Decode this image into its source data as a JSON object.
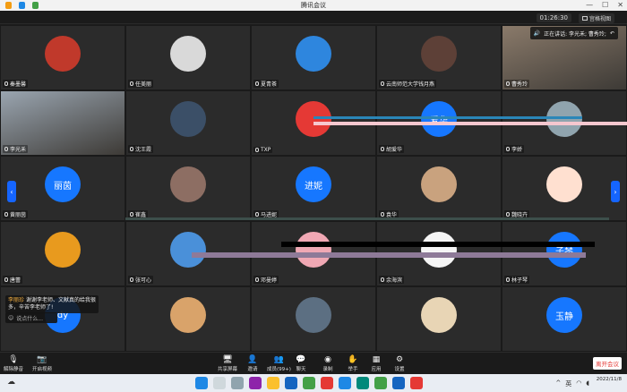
{
  "window": {
    "title": "腾讯会议",
    "controls": [
      "—",
      "☐",
      "✕"
    ]
  },
  "topbar": {
    "timer": "01:26:30",
    "gallery_label": "宫格视图"
  },
  "speaking": {
    "label": "正在讲话: 李光禾; 曹秀玲;"
  },
  "participants": [
    {
      "name": "秦墨馨",
      "kind": "avatar",
      "color": "#c0392b",
      "initial": ""
    },
    {
      "name": "任美丽",
      "kind": "avatar",
      "color": "#d9d9d9",
      "initial": ""
    },
    {
      "name": "夏青茶",
      "kind": "avatar",
      "color": "#2e86de",
      "initial": ""
    },
    {
      "name": "云南师范大学钱月燕",
      "kind": "avatar",
      "color": "#5d4037",
      "initial": ""
    },
    {
      "name": "曹秀玲",
      "kind": "video",
      "color": "#8a7a6a",
      "initial": ""
    },
    {
      "name": "李光禾",
      "kind": "video",
      "color": "#9aa5b0",
      "initial": ""
    },
    {
      "name": "沈王霞",
      "kind": "avatar",
      "color": "#3b4f67",
      "initial": ""
    },
    {
      "name": "TXP",
      "kind": "avatar",
      "color": "#e53935",
      "initial": ""
    },
    {
      "name": "胡爱华",
      "kind": "avatar",
      "color": "#1677ff",
      "initial": "爱华"
    },
    {
      "name": "李娇",
      "kind": "avatar",
      "color": "#90a4ae",
      "initial": ""
    },
    {
      "name": "黄丽茵",
      "kind": "avatar",
      "color": "#1677ff",
      "initial": "丽茵"
    },
    {
      "name": "崔鑫",
      "kind": "avatar",
      "color": "#8d6e63",
      "initial": ""
    },
    {
      "name": "马进妮",
      "kind": "avatar",
      "color": "#1677ff",
      "initial": "进妮"
    },
    {
      "name": "袁华",
      "kind": "avatar",
      "color": "#c9a27e",
      "initial": ""
    },
    {
      "name": "魏晓卉",
      "kind": "avatar",
      "color": "#ffe0d0",
      "initial": ""
    },
    {
      "name": "唐蕾",
      "kind": "avatar",
      "color": "#e89a1e",
      "initial": ""
    },
    {
      "name": "张可心",
      "kind": "avatar",
      "color": "#4a90d9",
      "initial": ""
    },
    {
      "name": "邓曼婷",
      "kind": "avatar",
      "color": "#f0a8b4",
      "initial": ""
    },
    {
      "name": "余海滨",
      "kind": "avatar",
      "color": "#f5f5f5",
      "initial": ""
    },
    {
      "name": "林子琴",
      "kind": "avatar",
      "color": "#1677ff",
      "initial": "子琴"
    },
    {
      "name": "",
      "kind": "avatar",
      "color": "#1677ff",
      "initial": "dy"
    },
    {
      "name": "",
      "kind": "avatar",
      "color": "#d9a36a",
      "initial": ""
    },
    {
      "name": "",
      "kind": "avatar",
      "color": "#5c6f82",
      "initial": ""
    },
    {
      "name": "",
      "kind": "avatar",
      "color": "#e8d5b5",
      "initial": ""
    },
    {
      "name": "",
      "kind": "avatar",
      "color": "#1677ff",
      "initial": "玉静"
    }
  ],
  "chat": {
    "sender": "李丽珍",
    "text": "谢谢李老师、文献真的给我很多，辛苦李老师了!",
    "input_placeholder": "说点什么..."
  },
  "toolbar": {
    "unmute": "解除静音",
    "video": "开启视频",
    "share": "共享屏幕",
    "invite": "邀请",
    "members": "成员(99+)",
    "chat": "聊天",
    "record": "录制",
    "raise": "举手",
    "apps": "应用",
    "settings": "设置",
    "leave": "离开会议"
  },
  "taskbar": {
    "lang": "英",
    "date": "2022/11/8"
  },
  "colors": {
    "accent": "#1677ff",
    "leave": "#e53935"
  }
}
